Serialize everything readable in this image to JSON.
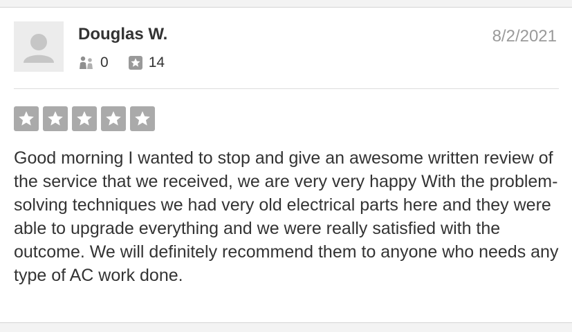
{
  "review": {
    "reviewer_name": "Douglas W.",
    "date": "8/2/2021",
    "friends_count": "0",
    "reviews_count": "14",
    "icons": {
      "avatar": "default-user-avatar",
      "friends": "friends-icon",
      "reviews": "review-star-icon",
      "rating_star": "star-icon"
    },
    "rating": 5,
    "rating_max": 5,
    "text": "Good morning I wanted to stop and give an awesome written review of the service that we received, we are very very happy With the problem-solving techniques we had very old electrical parts here and they were able to upgrade everything and we were really satisfied with the outcome. We will definitely recommend them to anyone who needs any type of AC work done."
  },
  "colors": {
    "page_background": "#f3f3f3",
    "card_background": "#ffffff",
    "star_fill": "#aaaaaa",
    "name_text": "#333333",
    "date_text": "#9a9a9a"
  }
}
